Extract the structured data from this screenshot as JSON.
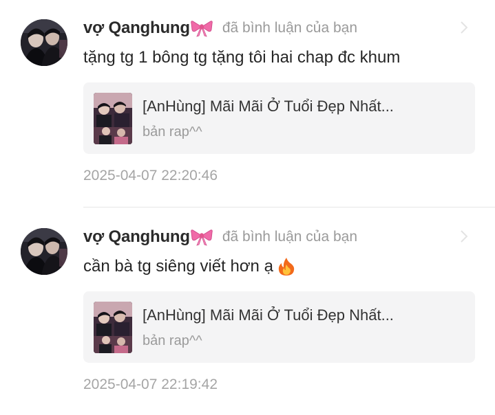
{
  "notifications": [
    {
      "username": "vợ Qanghung",
      "username_icon": "ribbon-bow-icon",
      "action": "đã bình luận của bạn",
      "comment": "tặng tg 1 bông tg tặng tôi hai chap đc khum",
      "comment_icon": "",
      "card": {
        "title": "[AnHùng] Mãi Mãi Ở Tuổi Đẹp Nhất...",
        "subtitle": "bản rap^^"
      },
      "timestamp": "2025-04-07 22:20:46"
    },
    {
      "username": "vợ Qanghung",
      "username_icon": "ribbon-bow-icon",
      "action": "đã bình luận của bạn",
      "comment": "cần bà tg siêng viết hơn ạ",
      "comment_icon": "fire-icon",
      "card": {
        "title": "[AnHùng] Mãi Mãi Ở Tuổi Đẹp Nhất...",
        "subtitle": "bản rap^^"
      },
      "timestamp": "2025-04-07 22:19:42"
    }
  ],
  "colors": {
    "username": "#2b2b2b",
    "secondary_text": "#9a9a9a",
    "card_background": "#f4f4f5",
    "divider": "#e6e6e6",
    "bow": "#f06aa8"
  }
}
